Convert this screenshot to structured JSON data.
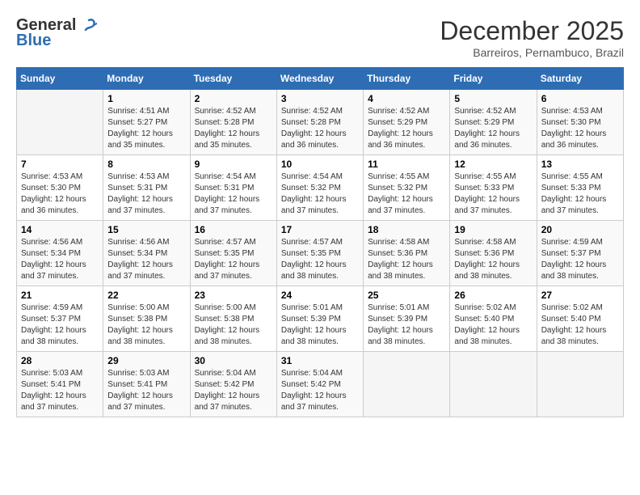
{
  "header": {
    "logo_general": "General",
    "logo_blue": "Blue",
    "month_title": "December 2025",
    "subtitle": "Barreiros, Pernambuco, Brazil"
  },
  "columns": [
    "Sunday",
    "Monday",
    "Tuesday",
    "Wednesday",
    "Thursday",
    "Friday",
    "Saturday"
  ],
  "weeks": [
    [
      {
        "day": "",
        "sunrise": "",
        "sunset": "",
        "daylight": ""
      },
      {
        "day": "1",
        "sunrise": "Sunrise: 4:51 AM",
        "sunset": "Sunset: 5:27 PM",
        "daylight": "Daylight: 12 hours and 35 minutes."
      },
      {
        "day": "2",
        "sunrise": "Sunrise: 4:52 AM",
        "sunset": "Sunset: 5:28 PM",
        "daylight": "Daylight: 12 hours and 35 minutes."
      },
      {
        "day": "3",
        "sunrise": "Sunrise: 4:52 AM",
        "sunset": "Sunset: 5:28 PM",
        "daylight": "Daylight: 12 hours and 36 minutes."
      },
      {
        "day": "4",
        "sunrise": "Sunrise: 4:52 AM",
        "sunset": "Sunset: 5:29 PM",
        "daylight": "Daylight: 12 hours and 36 minutes."
      },
      {
        "day": "5",
        "sunrise": "Sunrise: 4:52 AM",
        "sunset": "Sunset: 5:29 PM",
        "daylight": "Daylight: 12 hours and 36 minutes."
      },
      {
        "day": "6",
        "sunrise": "Sunrise: 4:53 AM",
        "sunset": "Sunset: 5:30 PM",
        "daylight": "Daylight: 12 hours and 36 minutes."
      }
    ],
    [
      {
        "day": "7",
        "sunrise": "Sunrise: 4:53 AM",
        "sunset": "Sunset: 5:30 PM",
        "daylight": "Daylight: 12 hours and 36 minutes."
      },
      {
        "day": "8",
        "sunrise": "Sunrise: 4:53 AM",
        "sunset": "Sunset: 5:31 PM",
        "daylight": "Daylight: 12 hours and 37 minutes."
      },
      {
        "day": "9",
        "sunrise": "Sunrise: 4:54 AM",
        "sunset": "Sunset: 5:31 PM",
        "daylight": "Daylight: 12 hours and 37 minutes."
      },
      {
        "day": "10",
        "sunrise": "Sunrise: 4:54 AM",
        "sunset": "Sunset: 5:32 PM",
        "daylight": "Daylight: 12 hours and 37 minutes."
      },
      {
        "day": "11",
        "sunrise": "Sunrise: 4:55 AM",
        "sunset": "Sunset: 5:32 PM",
        "daylight": "Daylight: 12 hours and 37 minutes."
      },
      {
        "day": "12",
        "sunrise": "Sunrise: 4:55 AM",
        "sunset": "Sunset: 5:33 PM",
        "daylight": "Daylight: 12 hours and 37 minutes."
      },
      {
        "day": "13",
        "sunrise": "Sunrise: 4:55 AM",
        "sunset": "Sunset: 5:33 PM",
        "daylight": "Daylight: 12 hours and 37 minutes."
      }
    ],
    [
      {
        "day": "14",
        "sunrise": "Sunrise: 4:56 AM",
        "sunset": "Sunset: 5:34 PM",
        "daylight": "Daylight: 12 hours and 37 minutes."
      },
      {
        "day": "15",
        "sunrise": "Sunrise: 4:56 AM",
        "sunset": "Sunset: 5:34 PM",
        "daylight": "Daylight: 12 hours and 37 minutes."
      },
      {
        "day": "16",
        "sunrise": "Sunrise: 4:57 AM",
        "sunset": "Sunset: 5:35 PM",
        "daylight": "Daylight: 12 hours and 37 minutes."
      },
      {
        "day": "17",
        "sunrise": "Sunrise: 4:57 AM",
        "sunset": "Sunset: 5:35 PM",
        "daylight": "Daylight: 12 hours and 38 minutes."
      },
      {
        "day": "18",
        "sunrise": "Sunrise: 4:58 AM",
        "sunset": "Sunset: 5:36 PM",
        "daylight": "Daylight: 12 hours and 38 minutes."
      },
      {
        "day": "19",
        "sunrise": "Sunrise: 4:58 AM",
        "sunset": "Sunset: 5:36 PM",
        "daylight": "Daylight: 12 hours and 38 minutes."
      },
      {
        "day": "20",
        "sunrise": "Sunrise: 4:59 AM",
        "sunset": "Sunset: 5:37 PM",
        "daylight": "Daylight: 12 hours and 38 minutes."
      }
    ],
    [
      {
        "day": "21",
        "sunrise": "Sunrise: 4:59 AM",
        "sunset": "Sunset: 5:37 PM",
        "daylight": "Daylight: 12 hours and 38 minutes."
      },
      {
        "day": "22",
        "sunrise": "Sunrise: 5:00 AM",
        "sunset": "Sunset: 5:38 PM",
        "daylight": "Daylight: 12 hours and 38 minutes."
      },
      {
        "day": "23",
        "sunrise": "Sunrise: 5:00 AM",
        "sunset": "Sunset: 5:38 PM",
        "daylight": "Daylight: 12 hours and 38 minutes."
      },
      {
        "day": "24",
        "sunrise": "Sunrise: 5:01 AM",
        "sunset": "Sunset: 5:39 PM",
        "daylight": "Daylight: 12 hours and 38 minutes."
      },
      {
        "day": "25",
        "sunrise": "Sunrise: 5:01 AM",
        "sunset": "Sunset: 5:39 PM",
        "daylight": "Daylight: 12 hours and 38 minutes."
      },
      {
        "day": "26",
        "sunrise": "Sunrise: 5:02 AM",
        "sunset": "Sunset: 5:40 PM",
        "daylight": "Daylight: 12 hours and 38 minutes."
      },
      {
        "day": "27",
        "sunrise": "Sunrise: 5:02 AM",
        "sunset": "Sunset: 5:40 PM",
        "daylight": "Daylight: 12 hours and 38 minutes."
      }
    ],
    [
      {
        "day": "28",
        "sunrise": "Sunrise: 5:03 AM",
        "sunset": "Sunset: 5:41 PM",
        "daylight": "Daylight: 12 hours and 37 minutes."
      },
      {
        "day": "29",
        "sunrise": "Sunrise: 5:03 AM",
        "sunset": "Sunset: 5:41 PM",
        "daylight": "Daylight: 12 hours and 37 minutes."
      },
      {
        "day": "30",
        "sunrise": "Sunrise: 5:04 AM",
        "sunset": "Sunset: 5:42 PM",
        "daylight": "Daylight: 12 hours and 37 minutes."
      },
      {
        "day": "31",
        "sunrise": "Sunrise: 5:04 AM",
        "sunset": "Sunset: 5:42 PM",
        "daylight": "Daylight: 12 hours and 37 minutes."
      },
      {
        "day": "",
        "sunrise": "",
        "sunset": "",
        "daylight": ""
      },
      {
        "day": "",
        "sunrise": "",
        "sunset": "",
        "daylight": ""
      },
      {
        "day": "",
        "sunrise": "",
        "sunset": "",
        "daylight": ""
      }
    ]
  ]
}
